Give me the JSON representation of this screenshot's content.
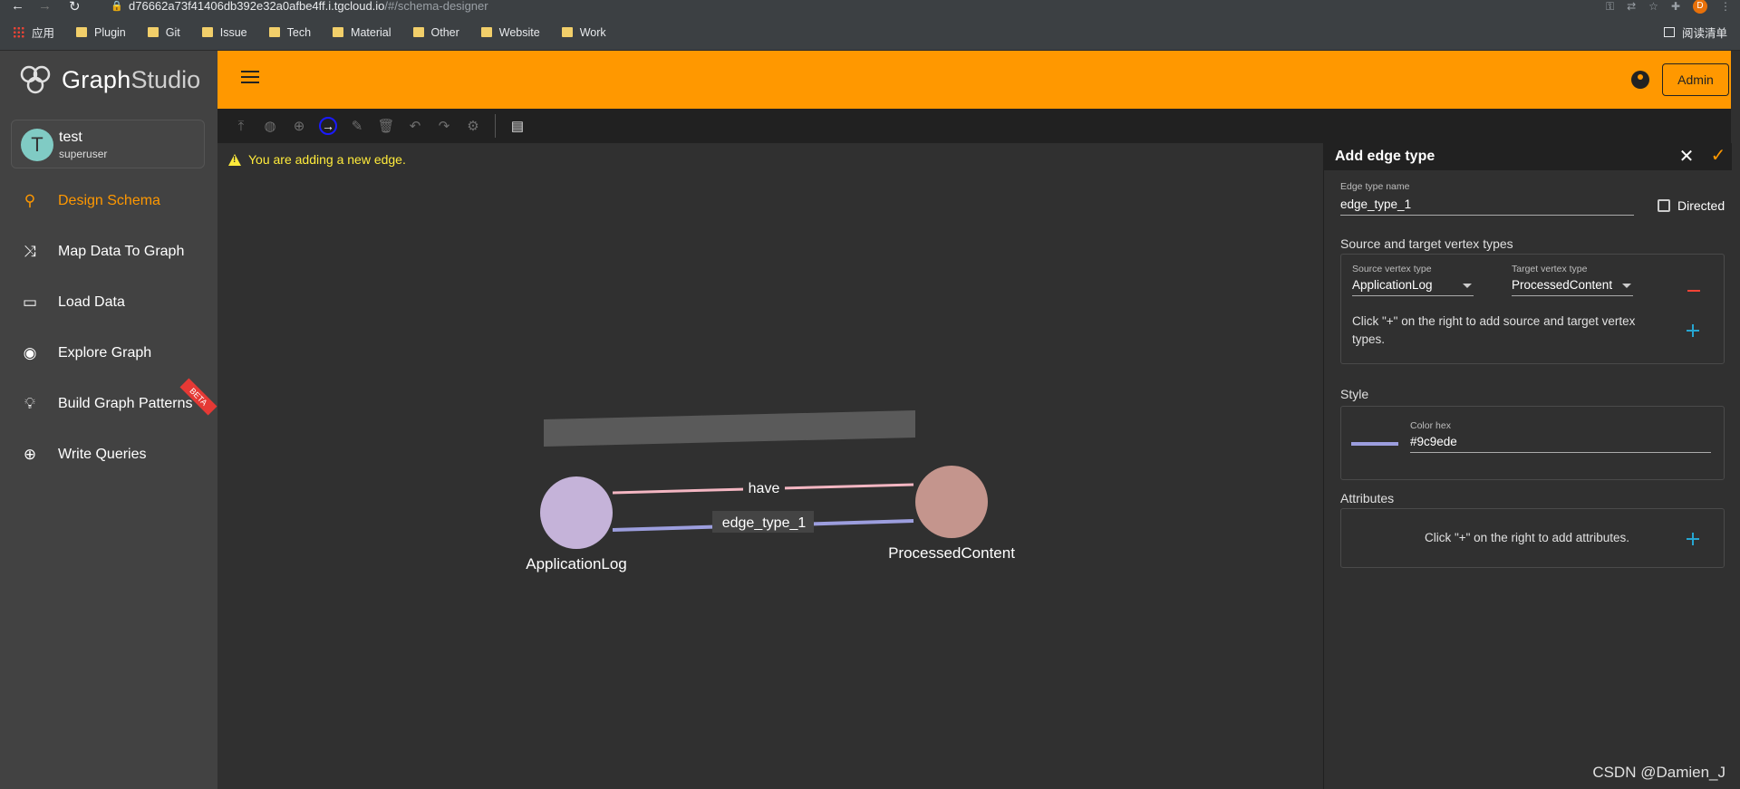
{
  "browser": {
    "url_host": "d76662a73f41406db392e32a0afbe4ff.i.tgcloud.io",
    "url_path": "/#/schema-designer",
    "profile_initial": "D",
    "bookmarks": [
      "应用",
      "Plugin",
      "Git",
      "Issue",
      "Tech",
      "Material",
      "Other",
      "Website",
      "Work"
    ],
    "reading_list": "阅读清单"
  },
  "app": {
    "logo_graph": "Graph",
    "logo_studio": "Studio",
    "admin_label": "Admin"
  },
  "user": {
    "initial": "T",
    "name": "test",
    "role": "superuser"
  },
  "sidebar": {
    "items": [
      {
        "label": "Design Schema",
        "icon": "schema-icon"
      },
      {
        "label": "Map Data To Graph",
        "icon": "shuffle-icon"
      },
      {
        "label": "Load Data",
        "icon": "load-icon"
      },
      {
        "label": "Explore Graph",
        "icon": "compass-icon"
      },
      {
        "label": "Build Graph Patterns",
        "icon": "bulb-icon"
      },
      {
        "label": "Write Queries",
        "icon": "globe-icon"
      }
    ],
    "beta_badge": "BETA"
  },
  "toolbar": {
    "icons": [
      "publish-icon",
      "global-icon",
      "add-vertex-icon",
      "add-edge-icon",
      "edit-icon",
      "delete-icon",
      "undo-icon",
      "redo-icon",
      "settings-icon",
      "document-icon"
    ]
  },
  "canvas": {
    "warning": "You are adding a new edge.",
    "vertices": [
      {
        "label": "ApplicationLog",
        "color": "#c5b3d9"
      },
      {
        "label": "ProcessedContent",
        "color": "#c4958d"
      }
    ],
    "edges": [
      {
        "label": "have",
        "color": "#f4b6c2"
      },
      {
        "label": "edge_type_1",
        "color": "#9c9ede"
      }
    ]
  },
  "panel": {
    "title": "Add edge type",
    "edge_name_label": "Edge type name",
    "edge_name_value": "edge_type_1",
    "directed_label": "Directed",
    "directed_checked": false,
    "source_target_title": "Source and target vertex types",
    "source_label": "Source vertex type",
    "source_value": "ApplicationLog",
    "target_label": "Target vertex type",
    "target_value": "ProcessedContent",
    "add_pair_hint": "Click \"+\" on the right to add source and target vertex types.",
    "style_title": "Style",
    "color_label": "Color hex",
    "color_value": "#9c9ede",
    "attributes_title": "Attributes",
    "attributes_hint": "Click \"+\" on the right to add attributes."
  },
  "watermark": "CSDN @Damien_J",
  "colors": {
    "accent": "#ff9800",
    "edge_new": "#9c9ede",
    "edge_have": "#f4b6c2",
    "warning": "#ffeb3b"
  }
}
